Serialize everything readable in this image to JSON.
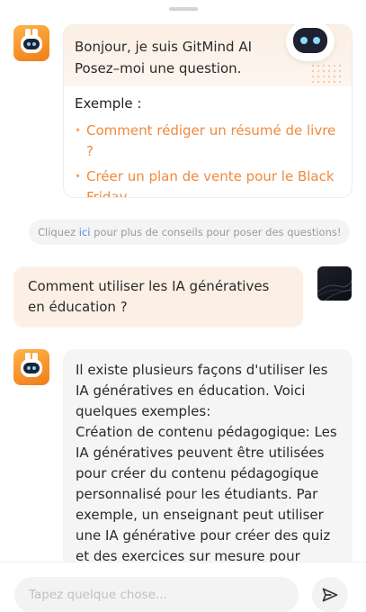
{
  "intro": {
    "greeting_line1": "Bonjour, je suis GitMind AI",
    "greeting_line2": "Posez–moi une question.",
    "example_title": "Exemple :",
    "examples": [
      "Comment rédiger un résumé de livre ?",
      "Créer un plan de vente pour le Black Friday."
    ]
  },
  "tip": {
    "before": "Cliquez ",
    "link": "ici",
    "after": " pour plus de conseils pour poser des questions!"
  },
  "messages": {
    "user": "Comment utiliser les IA génératives en éducation ?",
    "bot": "Il existe plusieurs façons d'utiliser les IA génératives en éducation. Voici quelques exemples:\nCréation de contenu pédagogique: Les IA génératives peuvent être utilisées pour créer du contenu pédagogique personnalisé pour les étudiants. Par exemple, un enseignant peut utiliser une IA générative pour créer des quiz et des exercices sur mesure pour"
  },
  "composer": {
    "placeholder": "Tapez quelque chose..."
  },
  "icons": {
    "bot_avatar": "robot-icon",
    "user_avatar": "user-avatar-image",
    "send": "send-icon",
    "mascot": "robot-mascot-icon"
  },
  "colors": {
    "accent": "#f08a3c",
    "user_bubble": "#fcefe5",
    "bot_bubble": "#f5f5f5",
    "link": "#4a8fe0"
  }
}
